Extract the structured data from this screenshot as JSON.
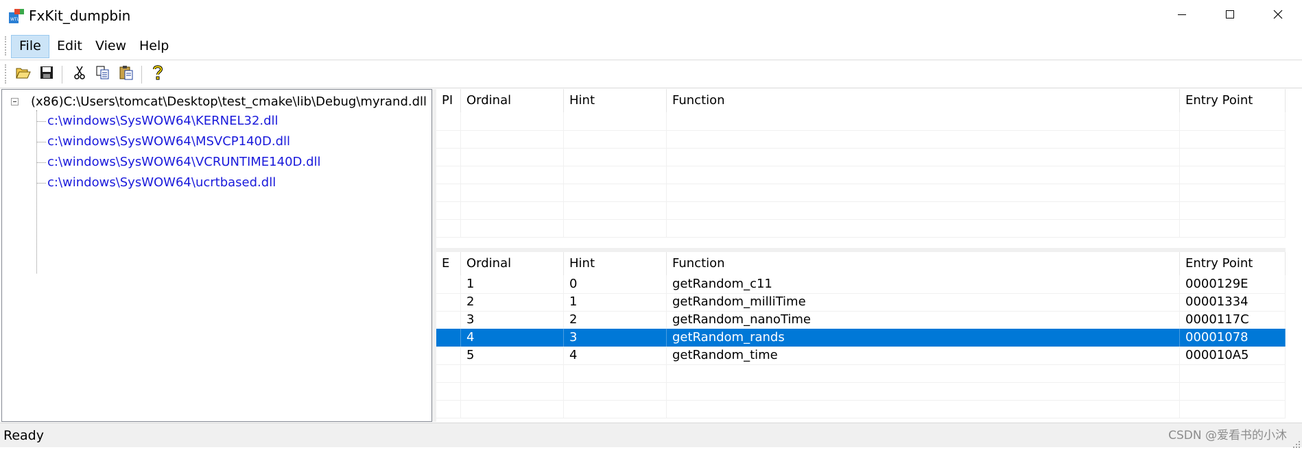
{
  "window": {
    "title": "FxKit_dumpbin",
    "icon": "wtl-app-icon",
    "controls": [
      "minimize-icon",
      "maximize-icon",
      "close-icon"
    ]
  },
  "menu": {
    "items": [
      {
        "label": "File",
        "active": true
      },
      {
        "label": "Edit",
        "active": false
      },
      {
        "label": "View",
        "active": false
      },
      {
        "label": "Help",
        "active": false
      }
    ]
  },
  "toolbar": {
    "buttons": [
      "open-folder-icon",
      "save-icon",
      "cut-icon",
      "copy-icon",
      "paste-icon",
      "help-icon"
    ]
  },
  "tree": {
    "root": "(x86)C:\\Users\\tomcat\\Desktop\\test_cmake\\lib\\Debug\\myrand.dll",
    "children": [
      "c:\\windows\\SysWOW64\\KERNEL32.dll",
      "c:\\windows\\SysWOW64\\MSVCP140D.dll",
      "c:\\windows\\SysWOW64\\VCRUNTIME140D.dll",
      "c:\\windows\\SysWOW64\\ucrtbased.dll"
    ]
  },
  "imports_table": {
    "columns": [
      "PI",
      "Ordinal",
      "Hint",
      "Function",
      "Entry Point"
    ],
    "rows": []
  },
  "exports_table": {
    "columns": [
      "E",
      "Ordinal",
      "Hint",
      "Function",
      "Entry Point"
    ],
    "rows": [
      {
        "e": "",
        "ordinal": "1",
        "hint": "0",
        "function": "getRandom_c11",
        "entry": "0000129E",
        "selected": false
      },
      {
        "e": "",
        "ordinal": "2",
        "hint": "1",
        "function": "getRandom_milliTime",
        "entry": "00001334",
        "selected": false
      },
      {
        "e": "",
        "ordinal": "3",
        "hint": "2",
        "function": "getRandom_nanoTime",
        "entry": "0000117C",
        "selected": false
      },
      {
        "e": "",
        "ordinal": "4",
        "hint": "3",
        "function": "getRandom_rands",
        "entry": "00001078",
        "selected": true
      },
      {
        "e": "",
        "ordinal": "5",
        "hint": "4",
        "function": "getRandom_time",
        "entry": "000010A5",
        "selected": false
      }
    ]
  },
  "status": {
    "text": "Ready",
    "watermark": "CSDN @爱看书的小沐"
  },
  "colors": {
    "selection": "#0078d7",
    "tree_child_text": "#1a1adb",
    "menu_active_bg": "#cce4f7"
  }
}
